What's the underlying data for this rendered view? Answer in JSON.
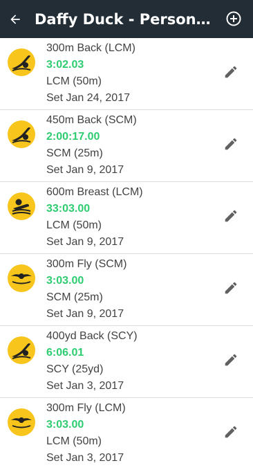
{
  "header": {
    "title": "Daffy Duck - Persona...",
    "back_icon": "arrow-left-icon",
    "add_icon": "add-circle-icon"
  },
  "colors": {
    "appbar": "#222d36",
    "time": "#2ecc71",
    "avatar": "#f7c51b"
  },
  "records": [
    {
      "event": "300m Back (LCM)",
      "time": "3:02.03",
      "course": "LCM (50m)",
      "date": "Set Jan 24, 2017",
      "stroke_icon": "backstroke-icon"
    },
    {
      "event": "450m Back (SCM)",
      "time": "2:00:17.00",
      "course": "SCM (25m)",
      "date": "Set Jan 9, 2017",
      "stroke_icon": "backstroke-icon"
    },
    {
      "event": "600m Breast (LCM)",
      "time": "33:03.00",
      "course": "LCM (50m)",
      "date": "Set Jan 9, 2017",
      "stroke_icon": "breaststroke-icon"
    },
    {
      "event": "300m Fly (SCM)",
      "time": "3:03.00",
      "course": "SCM (25m)",
      "date": "Set Jan 9, 2017",
      "stroke_icon": "butterfly-icon"
    },
    {
      "event": "400yd Back (SCY)",
      "time": "6:06.01",
      "course": "SCY (25yd)",
      "date": "Set Jan 3, 2017",
      "stroke_icon": "backstroke-icon"
    },
    {
      "event": "300m Fly (LCM)",
      "time": "3:03.00",
      "course": "LCM (50m)",
      "date": "Set Jan 3, 2017",
      "stroke_icon": "butterfly-icon"
    }
  ]
}
